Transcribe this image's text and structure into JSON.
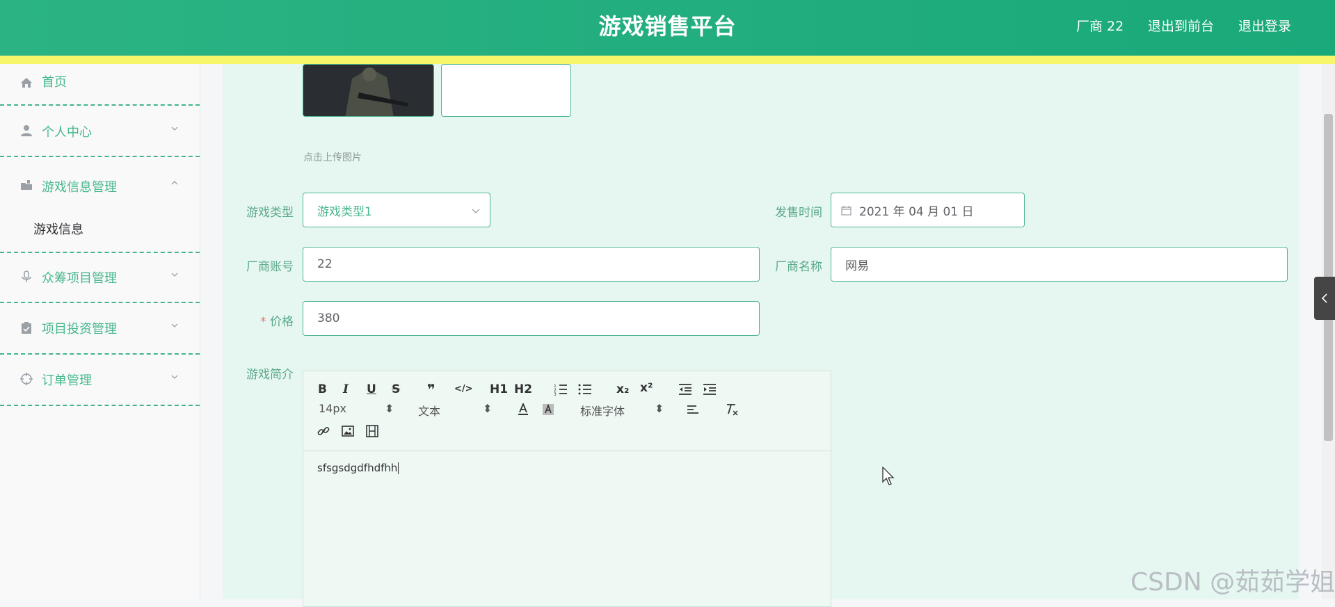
{
  "header": {
    "title": "游戏销售平台",
    "user": "厂商 22",
    "back_front": "退出到前台",
    "logout": "退出登录"
  },
  "sidebar": {
    "items": [
      {
        "label": "首页",
        "icon": "home-icon"
      },
      {
        "label": "个人中心",
        "icon": "user-icon"
      },
      {
        "label": "游戏信息管理",
        "icon": "folder-icon",
        "expanded": true,
        "children": [
          "游戏信息"
        ]
      },
      {
        "label": "众筹项目管理",
        "icon": "microphone-icon"
      },
      {
        "label": "项目投资管理",
        "icon": "clipboard-icon"
      },
      {
        "label": "订单管理",
        "icon": "target-icon"
      }
    ]
  },
  "form": {
    "upload_hint": "点击上传图片",
    "type_label": "游戏类型",
    "type_value": "游戏类型1",
    "release_label": "发售时间",
    "release_value": "2021 年 04 月 01 日",
    "vendor_account_label": "厂商账号",
    "vendor_account_value": "22",
    "vendor_name_label": "厂商名称",
    "vendor_name_value": "网易",
    "price_required": "*",
    "price_label": "价格",
    "price_value": "380",
    "intro_label": "游戏简介"
  },
  "editor": {
    "bold": "B",
    "italic": "I",
    "underline": "U",
    "strike": "S",
    "quote": "❞",
    "code": "</>",
    "h1": "H1",
    "h2": "H2",
    "sub": "x₂",
    "sup": "x²",
    "font_size": "14px",
    "text_type": "文本",
    "font_family": "标准字体",
    "content": "sfsgsdgdfhdfhh"
  },
  "watermark": "CSDN @茹茹学姐",
  "colors": {
    "header": "#1fae7e",
    "accent_line": "#f7f56a",
    "content_bg": "#e6f7f1",
    "accent": "#47b88c"
  }
}
